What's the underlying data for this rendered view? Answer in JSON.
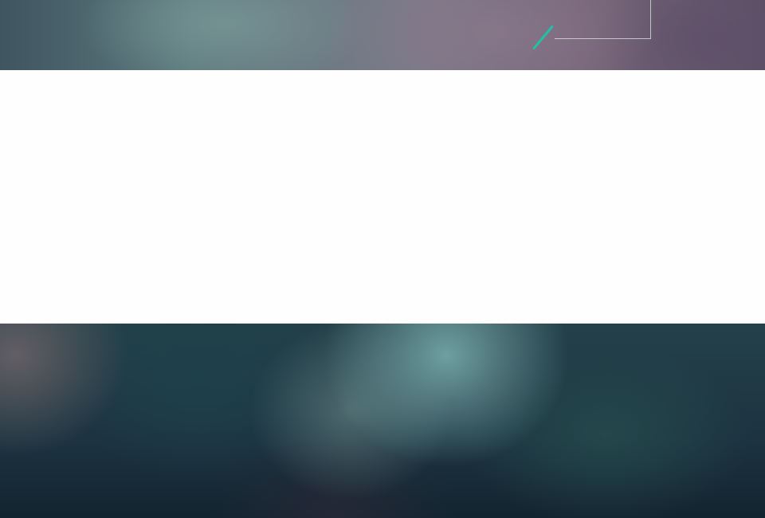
{
  "colors": {
    "accent": "#1fc2a5",
    "panel": "#fefefe"
  },
  "decorations": {
    "accent_mark": "slash-accent",
    "frame": "corner-bracket"
  }
}
